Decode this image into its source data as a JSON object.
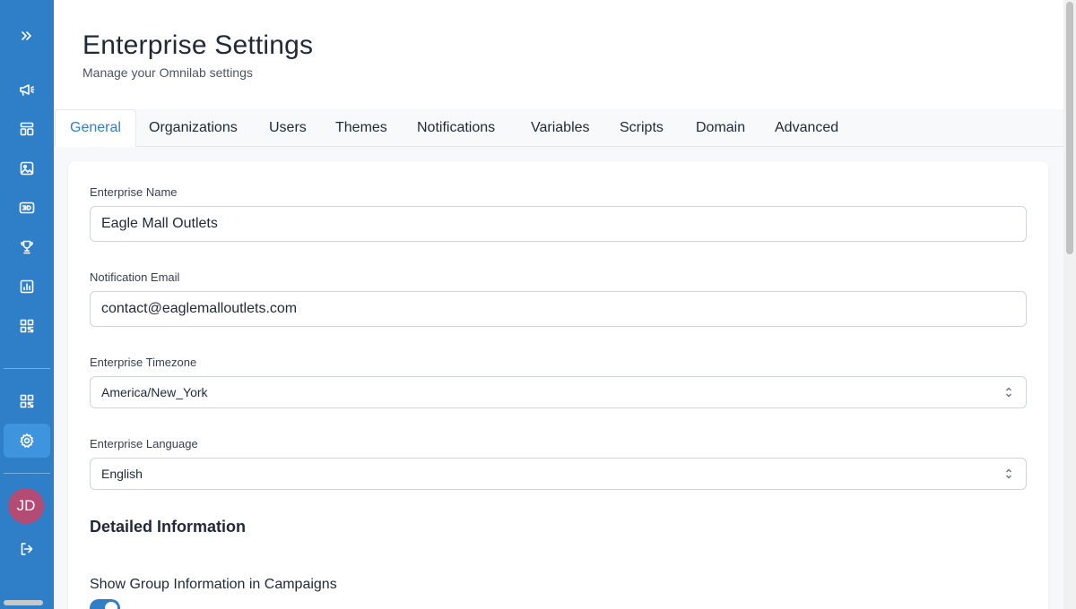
{
  "header": {
    "title": "Enterprise Settings",
    "subtitle": "Manage your Omnilab settings"
  },
  "sidebar": {
    "items": [
      {
        "icon": "chevrons-right-icon"
      },
      {
        "icon": "megaphone-icon"
      },
      {
        "icon": "layout-icon"
      },
      {
        "icon": "image-icon"
      },
      {
        "icon": "3d-icon"
      },
      {
        "icon": "trophy-icon"
      },
      {
        "icon": "bar-chart-icon"
      },
      {
        "icon": "qr-code-icon"
      },
      {
        "icon": "qr-code-icon"
      },
      {
        "icon": "gear-icon",
        "active": true
      },
      {
        "icon": "logout-icon"
      }
    ],
    "avatar_initials": "JD"
  },
  "tabs": [
    {
      "label": "General",
      "active": true
    },
    {
      "label": "Organizations"
    },
    {
      "label": "Users"
    },
    {
      "label": "Themes"
    },
    {
      "label": "Notifications"
    },
    {
      "label": "Variables"
    },
    {
      "label": "Scripts"
    },
    {
      "label": "Domain"
    },
    {
      "label": "Advanced"
    }
  ],
  "form": {
    "enterprise_name": {
      "label": "Enterprise Name",
      "value": "Eagle Mall Outlets"
    },
    "notification_email": {
      "label": "Notification Email",
      "value": "contact@eaglemalloutlets.com"
    },
    "timezone": {
      "label": "Enterprise Timezone",
      "value": "America/New_York"
    },
    "language": {
      "label": "Enterprise Language",
      "value": "English"
    },
    "section_heading": "Detailed Information",
    "show_group_info": {
      "label": "Show Group Information in Campaigns",
      "enabled": true
    }
  },
  "colors": {
    "sidebar": "#2f7fc8",
    "accent": "#2f7fc8",
    "avatar": "#b24c75"
  }
}
